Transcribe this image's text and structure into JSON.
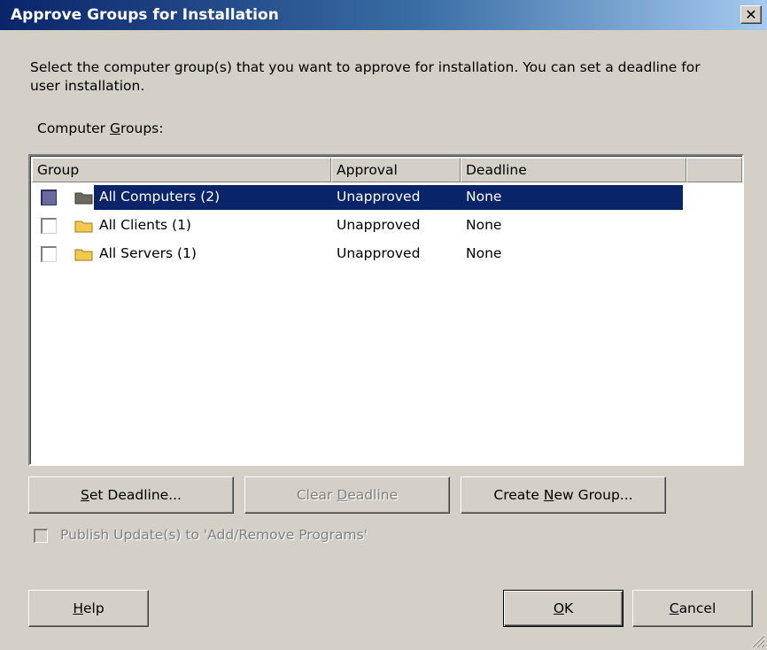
{
  "window": {
    "title": "Approve Groups for Installation",
    "close_label": "✕"
  },
  "description": "Select the computer group(s) that you want to approve for installation. You can set a deadline for user installation.",
  "groups_label": {
    "before": "Computer ",
    "accel": "G",
    "after": "roups:"
  },
  "listview": {
    "columns": [
      "Group",
      "Approval",
      "Deadline"
    ],
    "rows": [
      {
        "group": "All Computers (2)",
        "approval": "Unapproved",
        "deadline": "None",
        "selected": true
      },
      {
        "group": "All Clients (1)",
        "approval": "Unapproved",
        "deadline": "None",
        "selected": false
      },
      {
        "group": "All Servers (1)",
        "approval": "Unapproved",
        "deadline": "None",
        "selected": false
      }
    ]
  },
  "buttons": {
    "set_deadline": {
      "accel": "S",
      "rest": "et Deadline..."
    },
    "clear_deadline": {
      "before": "Clear ",
      "accel": "D",
      "after": "eadline"
    },
    "create_group": {
      "before": "Create ",
      "accel": "N",
      "after": "ew Group..."
    },
    "help": {
      "accel": "H",
      "rest": "elp"
    },
    "ok": {
      "accel": "O",
      "rest": "K"
    },
    "cancel": {
      "accel": "C",
      "rest": "ancel"
    }
  },
  "publish_checkbox_label": "Publish Update(s) to 'Add/Remove Programs'",
  "colors": {
    "selection": "#0a246a",
    "window_bg": "#d4d0c8",
    "folder": "#f2c94c"
  },
  "icons": [
    "folder-icon",
    "close-icon",
    "size-grip-icon"
  ]
}
